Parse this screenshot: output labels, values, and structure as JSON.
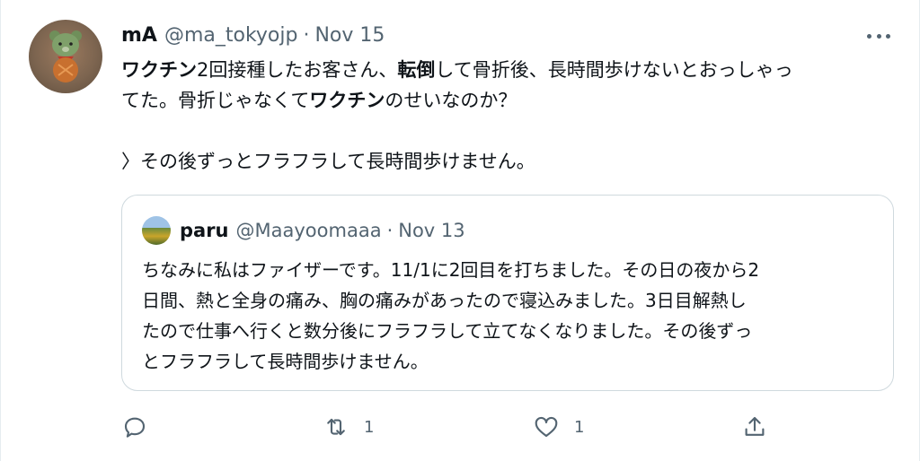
{
  "tweet": {
    "author_name": "mA",
    "author_handle": "@ma_tokyojp",
    "separator": "·",
    "date": "Nov 15",
    "text": {
      "line1": [
        {
          "t": "ワクチン",
          "b": true
        },
        {
          "t": "2回接種したお客さん、",
          "b": false
        },
        {
          "t": "転倒",
          "b": true
        },
        {
          "t": "して骨折後、長時間歩けないとおっしゃっ",
          "b": false
        }
      ],
      "line2": [
        {
          "t": "てた。骨折じゃなくて",
          "b": false
        },
        {
          "t": "ワクチン",
          "b": true
        },
        {
          "t": "のせいなのか？",
          "b": false
        }
      ],
      "line3": "〉その後ずっとフラフラして長時間歩けません。"
    }
  },
  "quote": {
    "author_name": "paru",
    "author_handle": "@Maayoomaaa",
    "separator": "·",
    "date": "Nov 13",
    "lines": [
      "ちなみに私はファイザーです。11/1に2回目を打ちました。その日の夜から2",
      "日間、熱と全身の痛み、胸の痛みがあったので寝込みました。3日目解熱し",
      "たので仕事へ行くと数分後にフラフラして立てなくなりました。その後ずっ",
      "とフラフラして長時間歩けません。"
    ]
  },
  "actions": {
    "reply_icon": "reply-icon",
    "retweet_icon": "retweet-icon",
    "retweet_count": "1",
    "like_icon": "heart-icon",
    "like_count": "1",
    "share_icon": "share-icon"
  },
  "colors": {
    "text": "#0f1419",
    "secondary": "#536471",
    "border": "#cfd9de"
  }
}
